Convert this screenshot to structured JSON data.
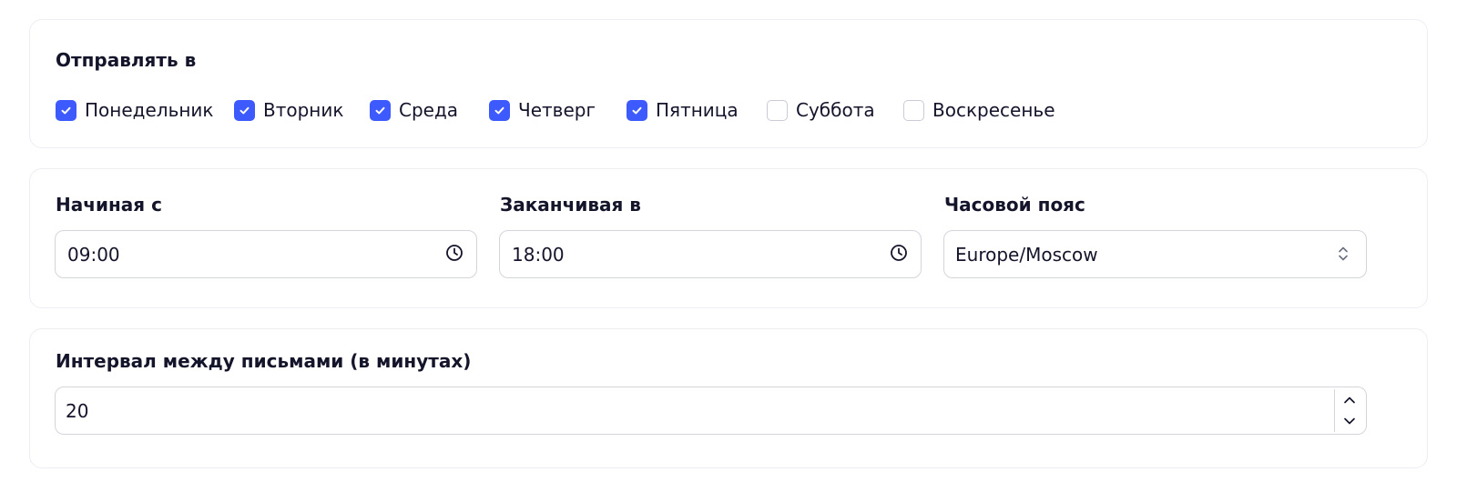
{
  "send_days": {
    "title": "Отправлять в",
    "days": [
      {
        "label": "Понедельник",
        "checked": true
      },
      {
        "label": "Вторник",
        "checked": true
      },
      {
        "label": "Среда",
        "checked": true
      },
      {
        "label": "Четверг",
        "checked": true
      },
      {
        "label": "Пятница",
        "checked": true
      },
      {
        "label": "Суббота",
        "checked": false
      },
      {
        "label": "Воскресенье",
        "checked": false
      }
    ]
  },
  "schedule": {
    "start": {
      "label": "Начиная с",
      "value": "09:00"
    },
    "end": {
      "label": "Заканчивая в",
      "value": "18:00"
    },
    "timezone": {
      "label": "Часовой пояс",
      "value": "Europe/Moscow"
    }
  },
  "interval": {
    "label": "Интервал между письмами (в минутах)",
    "value": "20"
  },
  "colors": {
    "accent": "#3d5afe",
    "text": "#14142b",
    "border": "#d2d5dc",
    "card_border": "#eceef3"
  }
}
